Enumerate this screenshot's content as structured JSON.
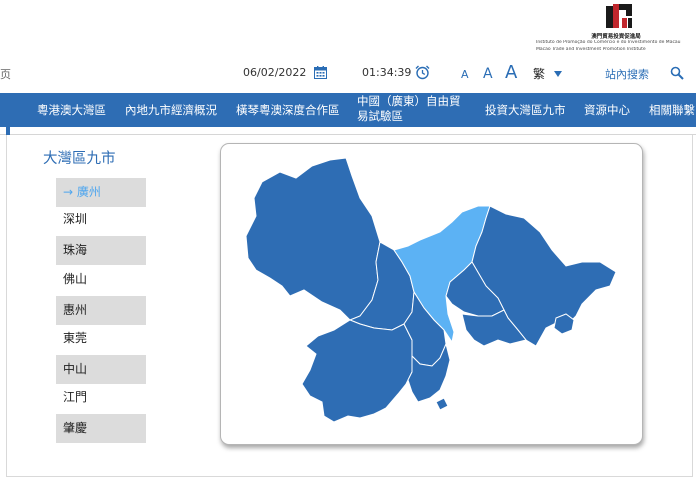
{
  "header": {
    "logo_name": "澳門貿易投資促進局",
    "logo_sub_pt": "Instituto de Promoção do Comércio e do Investimento de Macau",
    "logo_sub_en": "Macao Trade and Investment Promotion Institute",
    "left_fragment": "页",
    "date": "06/02/2022",
    "time": "01:34:39",
    "font_small": "A",
    "font_medium": "A",
    "font_large": "A",
    "language": "繁",
    "site_search": "站內搜索"
  },
  "nav": {
    "items": [
      {
        "label": "粵港澳大灣區"
      },
      {
        "label": "內地九市經濟概況"
      },
      {
        "label": "橫琴粵澳深度合作區"
      },
      {
        "label_line1": "中國（廣東）自由貿",
        "label_line2": "易試驗區"
      },
      {
        "label": "投資大灣區九市"
      },
      {
        "label": "資源中心"
      },
      {
        "label": "相關聯繫"
      }
    ]
  },
  "sidebar": {
    "title": "大灣區九市",
    "active_marker": "→",
    "cities": [
      "廣州",
      "深圳",
      "珠海",
      "佛山",
      "惠州",
      "東莞",
      "中山",
      "江門",
      "肇慶"
    ]
  },
  "map": {
    "selected_city": "廣州",
    "colors": {
      "region": "#2e6db4",
      "selected": "#5cb2f4",
      "border": "#ffffff"
    }
  },
  "theme": {
    "accent": "#2e6db4",
    "highlight": "#4fa6ee",
    "row_grey": "#dcdcdc"
  }
}
